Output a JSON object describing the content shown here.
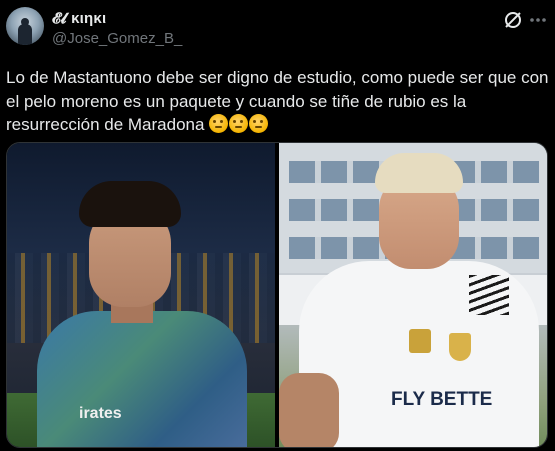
{
  "header": {
    "display_name": "𝓔𝓵 κιηκι",
    "handle": "@Jose_Gomez_B_"
  },
  "tweet": {
    "text": "Lo de Mastantuono debe ser digno de estudio, como puede ser que con el pelo moreno es un paquete y cuando se tiñe de rubio es la resurrección de Maradona",
    "emoji_count": 3
  },
  "media": {
    "left_shirt_text": "irates",
    "right_sponsor_text": "FLY BETTE"
  },
  "icons": {
    "grok": "grok-icon",
    "more": "more-icon"
  },
  "colors": {
    "background": "#000000",
    "text": "#e7e9ea",
    "secondary_text": "#71767b"
  }
}
